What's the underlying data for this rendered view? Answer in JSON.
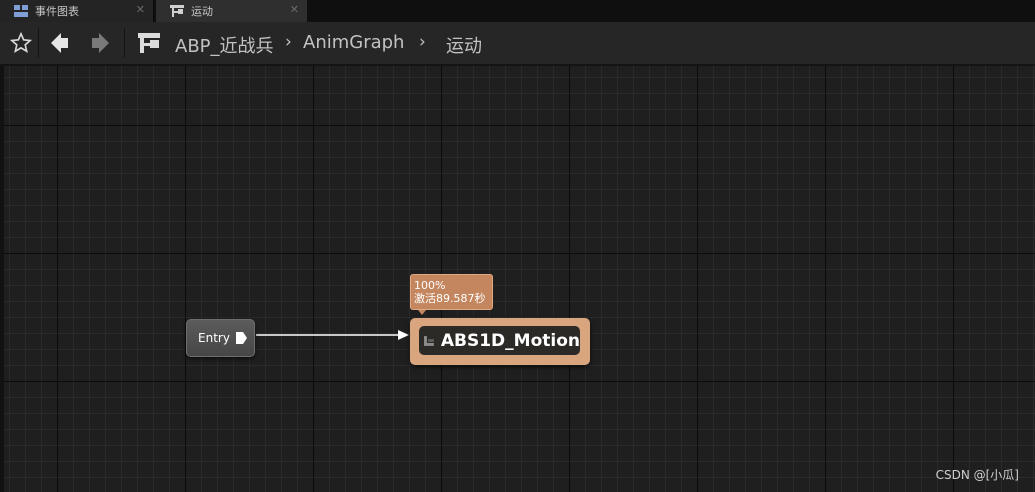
{
  "tabs": [
    {
      "label": "事件图表",
      "icon": "event-graph-icon",
      "active": false
    },
    {
      "label": "运动",
      "icon": "state-machine-icon",
      "active": true
    }
  ],
  "toolbar": {
    "breadcrumb": [
      "ABP_近战兵",
      "AnimGraph",
      "运动"
    ]
  },
  "graph": {
    "entry_node": {
      "label": "Entry"
    },
    "state_node": {
      "label": "ABS1D_Motion"
    },
    "debug_info": {
      "weight": "100%",
      "active_time": "激活89.587秒"
    }
  },
  "watermark": "CSDN @[小瓜]",
  "colors": {
    "state_node": "#d9a57f",
    "debug_bubble": "#c4865e",
    "entry_node": "#505050"
  }
}
